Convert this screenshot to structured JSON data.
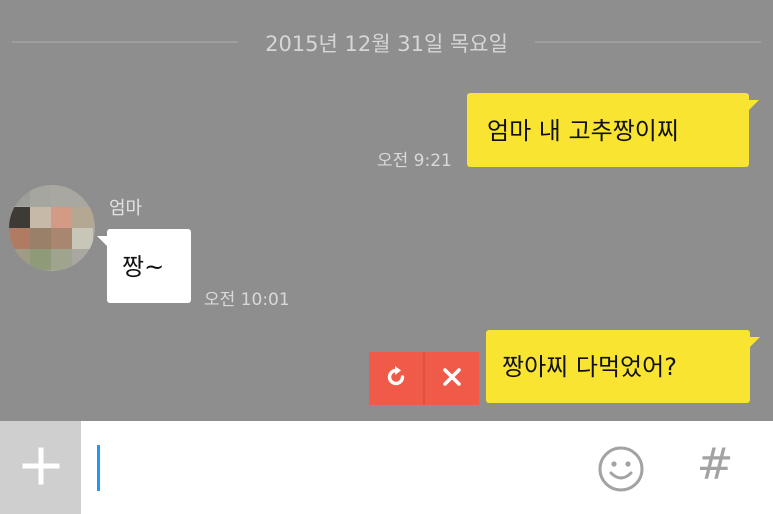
{
  "date_separator": "2015년 12월 31일 목요일",
  "messages": [
    {
      "text": "엄마 내 고추짱이찌",
      "time": "오전 9:21"
    },
    {
      "sender": "엄마",
      "text": "짱~",
      "time": "오전 10:01"
    },
    {
      "text": "짱아찌 다먹었어?",
      "failed": true
    }
  ],
  "icons": {
    "retry": "retry-icon",
    "cancel": "close-icon",
    "plus": "plus-icon",
    "emoji": "smiley-icon",
    "hash": "hash-icon"
  },
  "input": {
    "value": "",
    "hash_label": "#"
  },
  "colors": {
    "my_bubble": "#f9e431",
    "their_bubble": "#ffffff",
    "chat_background": "#8e8e8e",
    "failed_actions": "#ef5a49",
    "cursor": "#2196f3"
  }
}
